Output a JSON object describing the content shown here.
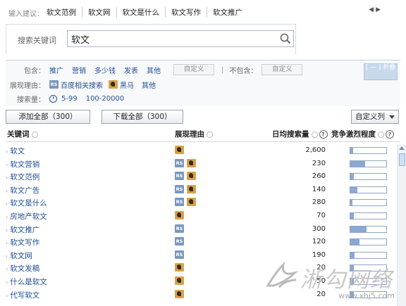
{
  "suggest_bar": {
    "prefix": "输入建议：",
    "links": [
      "软文范例",
      "软文网",
      "软文是什么",
      "软文写作",
      "软文推广"
    ],
    "prev_icon": "triangle-left-icon",
    "next_icon": "triangle-right-icon"
  },
  "search": {
    "label": "搜索关键词",
    "value": "软文",
    "icon": "search-icon"
  },
  "filters": {
    "include_label": "包含：",
    "include_terms": [
      "推广",
      "营销",
      "多少钱",
      "发表",
      "其他"
    ],
    "include_custom": "自定义",
    "separator": "|",
    "exclude_label": "不包含：",
    "exclude_custom": "自定义",
    "collapse_button": "[ — ] 折叠",
    "reason_label": "展现理由：",
    "reasons": [
      {
        "badge": "RS",
        "text": "百度相关搜索"
      },
      {
        "badge": "horse",
        "text": "黑马"
      },
      {
        "badge": "",
        "text": "其他"
      }
    ],
    "volume_label": "搜索量：",
    "volume_ranges": [
      "5-99",
      "100-20000"
    ]
  },
  "toolbar": {
    "add_all": "添加全部（300）",
    "download_all": "下载全部（300）",
    "custom_columns": "自定义列"
  },
  "table": {
    "headers": {
      "keyword": "关键词",
      "reason": "展现理由",
      "volume": "日均搜索量",
      "competition": "竞争激烈程度"
    },
    "rows": [
      {
        "keyword": "软文",
        "reasons": [
          "horse"
        ],
        "volume": "2,600",
        "competition": 0.08
      },
      {
        "keyword": "软文营销",
        "reasons": [
          "RS",
          "horse"
        ],
        "volume": "230",
        "competition": 0.42
      },
      {
        "keyword": "软文范例",
        "reasons": [
          "RS",
          "horse"
        ],
        "volume": "260",
        "competition": 0.1
      },
      {
        "keyword": "软文广告",
        "reasons": [
          "RS",
          "horse"
        ],
        "volume": "140",
        "competition": 0.2
      },
      {
        "keyword": "软文是什么",
        "reasons": [
          "RS",
          "horse"
        ],
        "volume": "280",
        "competition": 0.06
      },
      {
        "keyword": "房地产软文",
        "reasons": [
          "horse"
        ],
        "volume": "70",
        "competition": 0.1
      },
      {
        "keyword": "软文推广",
        "reasons": [
          "RS"
        ],
        "volume": "300",
        "competition": 0.45
      },
      {
        "keyword": "软文写作",
        "reasons": [
          "RS"
        ],
        "volume": "120",
        "competition": 0.25
      },
      {
        "keyword": "软文网",
        "reasons": [
          "RS"
        ],
        "volume": "190",
        "competition": 0.12
      },
      {
        "keyword": "软文发稿",
        "reasons": [
          "horse"
        ],
        "volume": "20",
        "competition": 0.1
      },
      {
        "keyword": "什么是软文",
        "reasons": [
          "horse"
        ],
        "volume": "50",
        "competition": 0.1
      },
      {
        "keyword": "代写软文",
        "reasons": [
          "horse"
        ],
        "volume": "20",
        "competition": 0.1
      }
    ]
  },
  "watermark": {
    "text": "淅勾网络",
    "url": "www.xhj5.com"
  },
  "colors": {
    "link": "#1f4f94",
    "bar_border": "#8fa6c6",
    "bar_fill": "#8aa8d2",
    "rs_badge": "#7d97be",
    "horse_badge": "#d8a24a"
  }
}
